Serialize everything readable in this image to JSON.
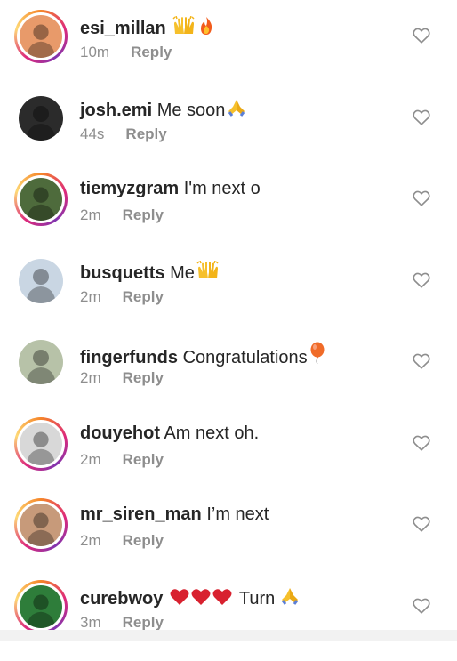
{
  "comments": [
    {
      "username": "esi_millan",
      "text": "",
      "emojis": [
        "raised-hands",
        "fire"
      ],
      "time": "10m",
      "reply": "Reply",
      "ring": true,
      "avatar_bg": "#e89a6a"
    },
    {
      "username": "josh.emi",
      "text": "Me soon",
      "emojis": [
        "folded-hands"
      ],
      "time": "44s",
      "reply": "Reply",
      "ring": false,
      "avatar_bg": "#2b2b2b"
    },
    {
      "username": "tiemyzgram",
      "text": "I'm next o",
      "emojis": [],
      "time": "2m",
      "reply": "Reply",
      "ring": true,
      "avatar_bg": "#4e6b3c"
    },
    {
      "username": "busquetts",
      "text": "Me",
      "emojis": [
        "raised-hands"
      ],
      "time": "2m",
      "reply": "Reply",
      "ring": false,
      "avatar_bg": "#c9d6e3"
    },
    {
      "username": "fingerfunds",
      "text": "Congratulations",
      "emojis": [
        "balloon"
      ],
      "time": "2m",
      "reply": "Reply",
      "ring": false,
      "avatar_bg": "#b7c2a8"
    },
    {
      "username": "douyehot",
      "text": "Am next oh.",
      "emojis": [],
      "time": "2m",
      "reply": "Reply",
      "ring": true,
      "avatar_bg": "#d8d8d8"
    },
    {
      "username": "mr_siren_man",
      "text": "I’m next",
      "emojis": [],
      "time": "2m",
      "reply": "Reply",
      "ring": true,
      "avatar_bg": "#c79a7a"
    },
    {
      "username": "curebwoy",
      "text": "Turn",
      "emojis": [
        "heart",
        "heart",
        "heart",
        "folded-hands"
      ],
      "time": "3m",
      "reply": "Reply",
      "ring": true,
      "avatar_bg": "#2e7d3a"
    }
  ],
  "icons": {
    "like": "heart-outline-icon"
  },
  "colors": {
    "username": "#262626",
    "meta": "#8e8e8e",
    "heart": "#8e8e8e",
    "ring_start": "#f58529",
    "ring_end": "#dd2a7b"
  }
}
